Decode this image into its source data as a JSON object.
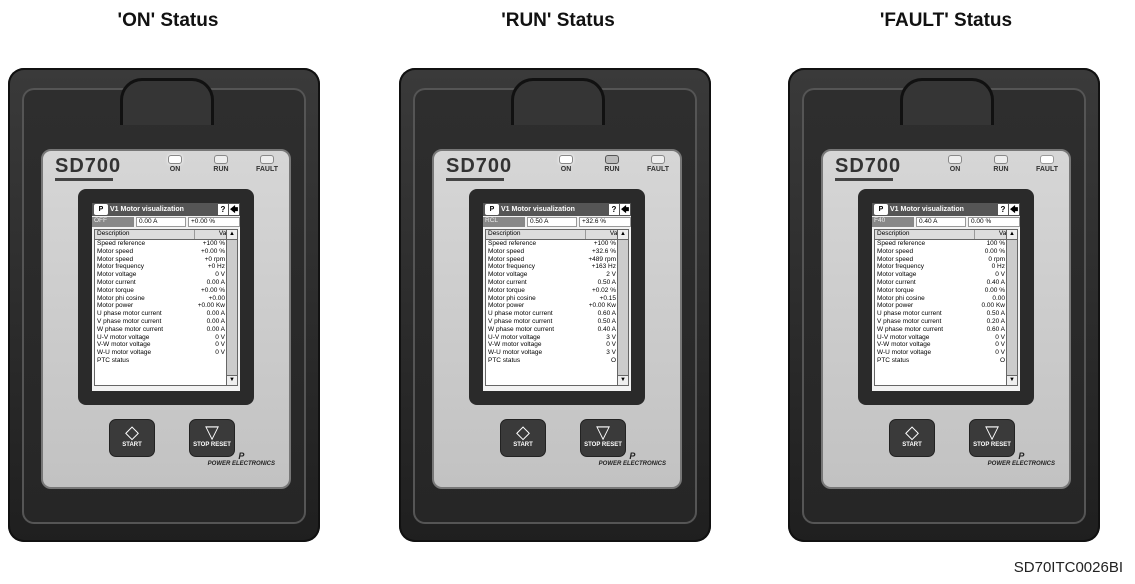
{
  "code": "SD70ITC0026BI",
  "panels": [
    {
      "title": "'ON' Status",
      "state": "ON",
      "status_cell": "OFF",
      "current": "0.00 A",
      "percent": "+0.00 %",
      "rows": [
        [
          "Speed reference",
          "+100 %"
        ],
        [
          "Motor speed",
          "+0.00 %"
        ],
        [
          "Motor speed",
          "+0 rpm"
        ],
        [
          "Motor frequency",
          "+0 Hz"
        ],
        [
          "Motor voltage",
          "0 V"
        ],
        [
          "Motor current",
          "0.00 A"
        ],
        [
          "Motor torque",
          "+0.00 %"
        ],
        [
          "Motor phi cosine",
          "+0.00"
        ],
        [
          "Motor power",
          "+0.00 Kw"
        ],
        [
          "U phase motor current",
          "0.00 A"
        ],
        [
          "V phase motor current",
          "0.00 A"
        ],
        [
          "W phase motor current",
          "0.00 A"
        ],
        [
          "U-V motor voltage",
          "0 V"
        ],
        [
          "V-W motor voltage",
          "0 V"
        ],
        [
          "W-U motor voltage",
          "0 V"
        ],
        [
          "PTC status",
          ""
        ]
      ]
    },
    {
      "title": "'RUN' Status",
      "state": "RUN",
      "status_cell": "RCL",
      "current": "0.50 A",
      "percent": "+32.6 %",
      "rows": [
        [
          "Speed reference",
          "+100 %"
        ],
        [
          "Motor speed",
          "+32.6 %"
        ],
        [
          "Motor speed",
          "+489 rpm"
        ],
        [
          "Motor frequency",
          "+163 Hz"
        ],
        [
          "Motor voltage",
          "2 V"
        ],
        [
          "Motor current",
          "0.50 A"
        ],
        [
          "Motor torque",
          "+0.02 %"
        ],
        [
          "Motor phi cosine",
          "+0.15"
        ],
        [
          "Motor power",
          "+0.00 Kw"
        ],
        [
          "U phase motor current",
          "0.60 A"
        ],
        [
          "V phase motor current",
          "0.50 A"
        ],
        [
          "W phase motor current",
          "0.40 A"
        ],
        [
          "U-V motor voltage",
          "3 V"
        ],
        [
          "V-W motor voltage",
          "0 V"
        ],
        [
          "W-U motor voltage",
          "3 V"
        ],
        [
          "PTC status",
          "O"
        ]
      ]
    },
    {
      "title": "'FAULT' Status",
      "state": "FAULT",
      "status_cell": "F40",
      "current": "0.40 A",
      "percent": "0.00 %",
      "rows": [
        [
          "Speed reference",
          "100 %"
        ],
        [
          "Motor speed",
          "0.00 %"
        ],
        [
          "Motor speed",
          "0 rpm"
        ],
        [
          "Motor frequency",
          "0 Hz"
        ],
        [
          "Motor voltage",
          "0 V"
        ],
        [
          "Motor current",
          "0.40 A"
        ],
        [
          "Motor torque",
          "0.00 %"
        ],
        [
          "Motor phi cosine",
          "0.00"
        ],
        [
          "Motor power",
          "0.00 Kw"
        ],
        [
          "U phase motor current",
          "0.50 A"
        ],
        [
          "V phase motor current",
          "0.20 A"
        ],
        [
          "W phase motor current",
          "0.60 A"
        ],
        [
          "U-V motor voltage",
          "0 V"
        ],
        [
          "V-W motor voltage",
          "0 V"
        ],
        [
          "W-U motor voltage",
          "0 V"
        ],
        [
          "PTC status",
          "O"
        ]
      ]
    }
  ],
  "device": {
    "logo": "SD700",
    "led_labels": [
      "ON",
      "RUN",
      "FAULT"
    ],
    "screen_title": "V1 Motor visualization",
    "help_glyph": "?",
    "back_glyph": "🡄",
    "header_desc": "Description",
    "header_value": "Value",
    "scroll_up": "▲",
    "scroll_down": "▼",
    "start_label": "START",
    "stop_label": "STOP RESET",
    "start_glyph": "◇",
    "stop_glyph": "▽",
    "brand": "POWER ELECTRONICS",
    "brand_mark": "P"
  }
}
